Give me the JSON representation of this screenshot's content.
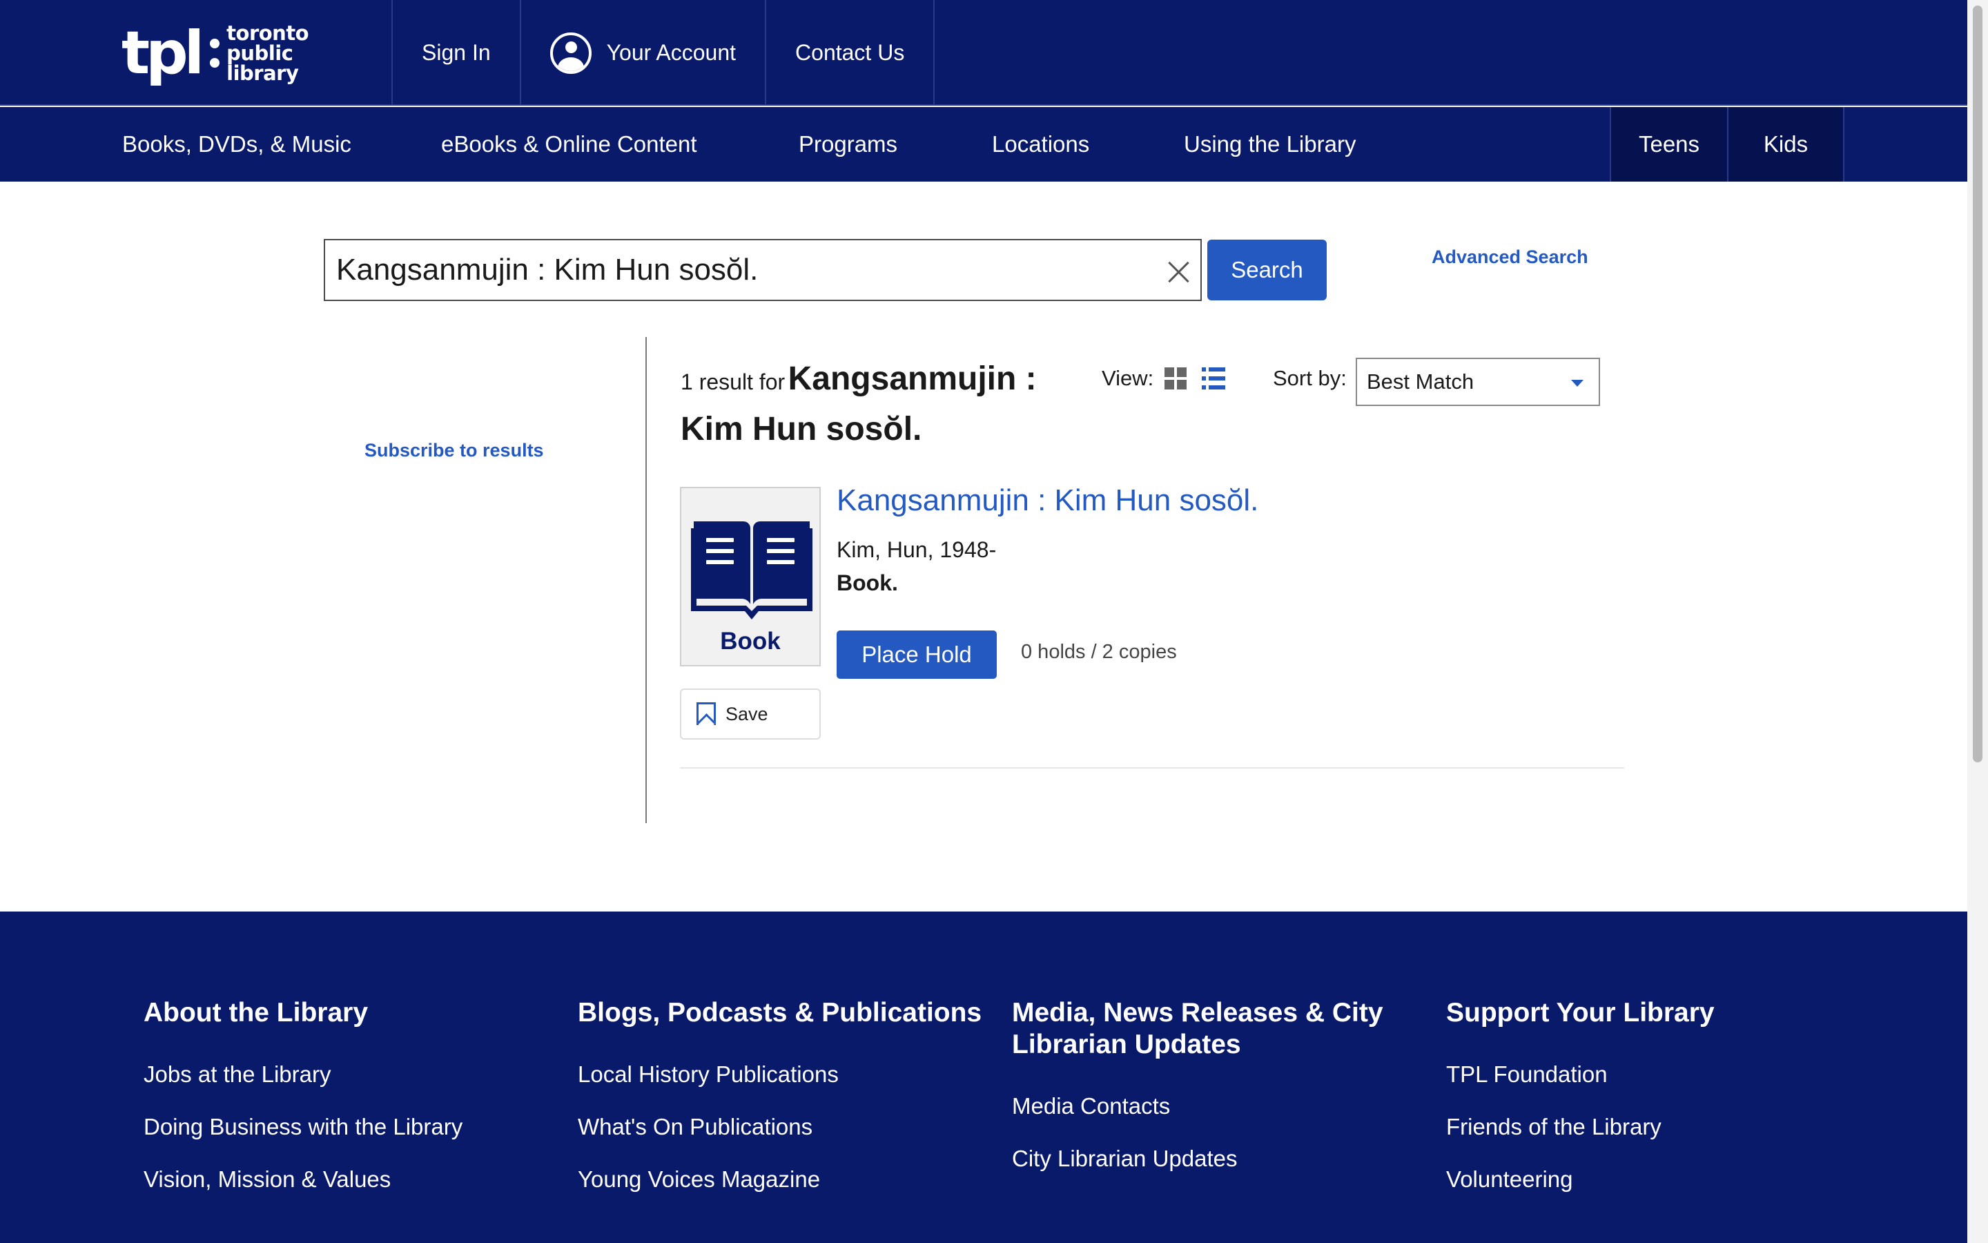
{
  "header": {
    "logo": {
      "mark": "tpl",
      "line1": "toronto",
      "line2": "public library"
    },
    "top_links": [
      "Sign In",
      "Your Account",
      "Contact Us"
    ]
  },
  "main_nav": {
    "items": [
      "Books, DVDs, & Music",
      "eBooks & Online Content",
      "Programs",
      "Locations",
      "Using the Library"
    ],
    "side": [
      "Teens",
      "Kids"
    ]
  },
  "search": {
    "value": "Kangsanmujin : Kim Hun sosŏl.",
    "button": "Search",
    "advanced": "Advanced Search"
  },
  "sidebar": {
    "subscribe": "Subscribe to results"
  },
  "results": {
    "count_text": "1 result for",
    "query": "Kangsanmujin : Kim Hun sosŏl.",
    "view_label": "View:",
    "sort_label": "Sort by:",
    "sort_value": "Best Match",
    "items": [
      {
        "format_badge": "Book",
        "title": "Kangsanmujin : Kim Hun sosŏl.",
        "author": "Kim, Hun, 1948-",
        "format": "Book.",
        "hold_button": "Place Hold",
        "holds": "0 holds / 2  copies",
        "save": "Save"
      }
    ]
  },
  "footer": {
    "columns": [
      {
        "title": "About the Library",
        "links": [
          "Jobs at the Library",
          "Doing Business with the Library",
          "Vision, Mission & Values"
        ]
      },
      {
        "title": "Blogs, Podcasts & Publications",
        "links": [
          "Local History Publications",
          "What's On Publications",
          "Young Voices Magazine"
        ]
      },
      {
        "title": "Media, News Releases & City Librarian Updates",
        "links": [
          "Media Contacts",
          "City Librarian Updates"
        ]
      },
      {
        "title": "Support Your Library",
        "links": [
          "TPL Foundation",
          "Friends of the Library",
          "Volunteering"
        ]
      }
    ]
  },
  "colors": {
    "navy": "#0a1a6a",
    "navy_dark": "#06124f",
    "accent": "#2459c2"
  }
}
